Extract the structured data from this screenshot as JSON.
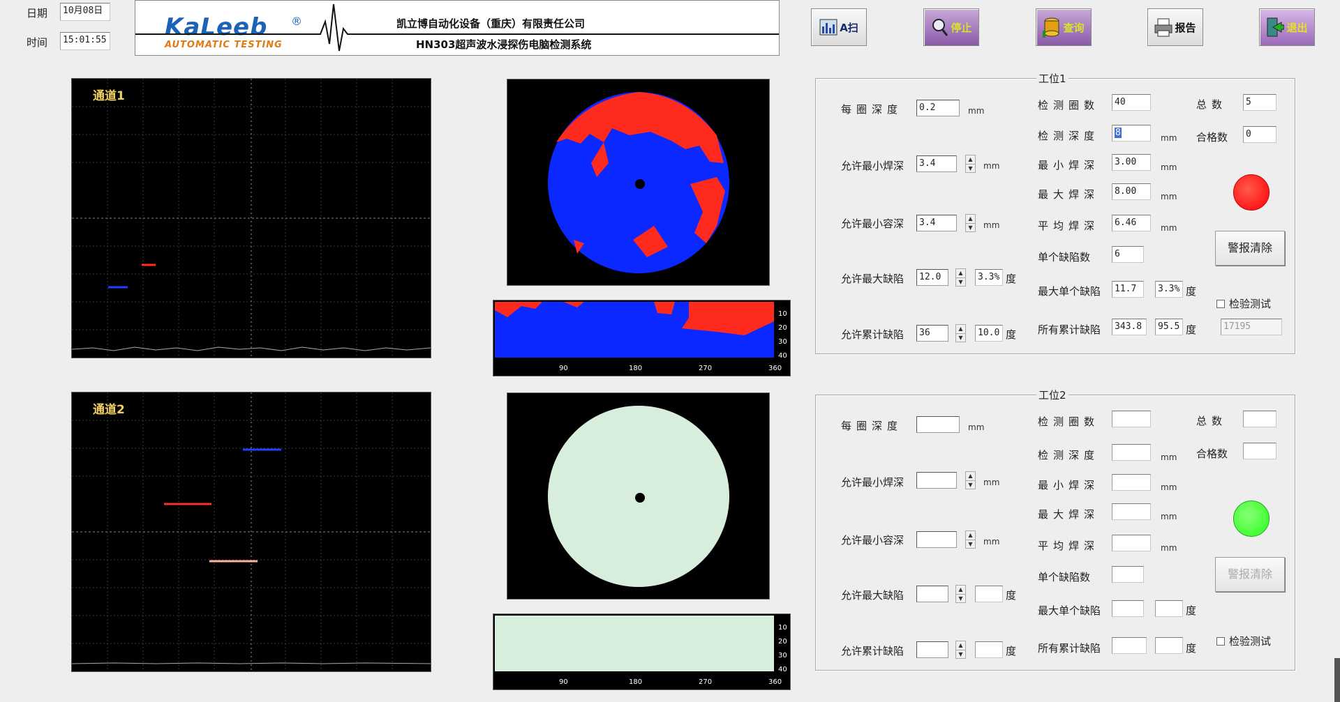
{
  "header": {
    "date_label": "日期",
    "date_value": "10月08日",
    "time_label": "时间",
    "time_value": "15:01:55",
    "logo_text": "KaLeeb",
    "logo_reg": "®",
    "logo_sub": "AUTOMATIC TESTING",
    "company": "凯立博自动化设备（重庆）有限责任公司",
    "system_title": "HN303超声波水浸探伤电脑检测系统"
  },
  "toolbar": [
    {
      "name": "a-scan",
      "label": "A扫",
      "icon": "chart-icon",
      "color": "#1a2b6a"
    },
    {
      "name": "stop",
      "label": "停止",
      "icon": "magnifier-icon",
      "color": "#d8e030"
    },
    {
      "name": "query",
      "label": "查询",
      "icon": "database-icon",
      "color": "#d8e030"
    },
    {
      "name": "report",
      "label": "报告",
      "icon": "printer-icon",
      "color": "#111111"
    },
    {
      "name": "exit",
      "label": "退出",
      "icon": "exit-icon",
      "color": "#e8e020"
    }
  ],
  "channels": [
    {
      "label": "通道1"
    },
    {
      "label": "通道2"
    }
  ],
  "bscan_ticks": {
    "x": [
      "90",
      "180",
      "270",
      "360"
    ],
    "y": [
      "10",
      "20",
      "30",
      "40"
    ]
  },
  "colors": {
    "defect": "#ff2a1e",
    "good": "#0a28ff",
    "idle": "#d8eedc",
    "alarm_red": "#ff1a1a",
    "alarm_green": "#44ff33"
  },
  "station1": {
    "title": "工位1",
    "labels": {
      "depth_per_rev": "每圈深度",
      "min_weld": "允许最小焊深",
      "min_fuse": "允许最小容深",
      "max_defect": "允许最大缺陷",
      "cum_defect": "允许累计缺陷",
      "rev_count": "检测圈数",
      "test_depth": "检测深度",
      "min_weld_depth": "最小焊深",
      "max_weld_depth": "最大焊深",
      "avg_weld_depth": "平均焊深",
      "single_defects": "单个缺陷数",
      "max_single": "最大单个缺陷",
      "all_cum": "所有累计缺陷",
      "total": "总数",
      "qualified": "合格数",
      "unit_mm": "mm",
      "unit_deg": "度",
      "alarm_clear": "警报清除",
      "verify_test": "检验测试"
    },
    "values": {
      "depth_per_rev": "0.2",
      "min_weld": "3.4",
      "min_fuse": "3.4",
      "max_defect": "12.0",
      "max_defect_pct": "3.3%",
      "cum_defect": "36",
      "cum_defect_pct": "10.0",
      "rev_count": "40",
      "test_depth": "8",
      "min_weld_depth": "3.00",
      "max_weld_depth": "8.00",
      "avg_weld_depth": "6.46",
      "single_defects": "6",
      "max_single": "11.7",
      "max_single_pct": "3.3%",
      "all_cum": "343.8",
      "all_cum_pct": "95.5",
      "total": "5",
      "qualified": "0",
      "counter": "17195"
    }
  },
  "station2": {
    "title": "工位2"
  }
}
